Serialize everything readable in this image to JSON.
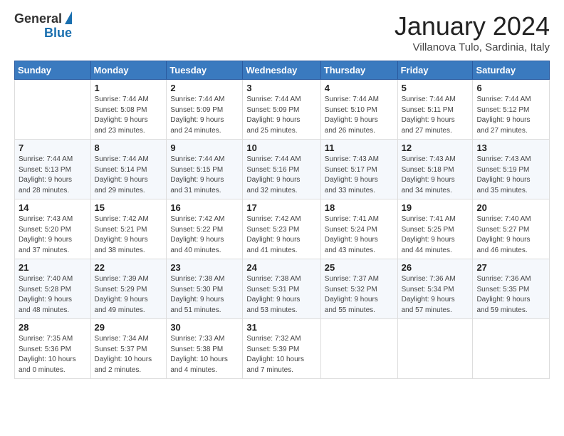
{
  "header": {
    "logo_line1": "General",
    "logo_line2": "Blue",
    "month_title": "January 2024",
    "location": "Villanova Tulo, Sardinia, Italy"
  },
  "weekdays": [
    "Sunday",
    "Monday",
    "Tuesday",
    "Wednesday",
    "Thursday",
    "Friday",
    "Saturday"
  ],
  "weeks": [
    [
      {
        "day": "",
        "info": ""
      },
      {
        "day": "1",
        "info": "Sunrise: 7:44 AM\nSunset: 5:08 PM\nDaylight: 9 hours\nand 23 minutes."
      },
      {
        "day": "2",
        "info": "Sunrise: 7:44 AM\nSunset: 5:09 PM\nDaylight: 9 hours\nand 24 minutes."
      },
      {
        "day": "3",
        "info": "Sunrise: 7:44 AM\nSunset: 5:09 PM\nDaylight: 9 hours\nand 25 minutes."
      },
      {
        "day": "4",
        "info": "Sunrise: 7:44 AM\nSunset: 5:10 PM\nDaylight: 9 hours\nand 26 minutes."
      },
      {
        "day": "5",
        "info": "Sunrise: 7:44 AM\nSunset: 5:11 PM\nDaylight: 9 hours\nand 27 minutes."
      },
      {
        "day": "6",
        "info": "Sunrise: 7:44 AM\nSunset: 5:12 PM\nDaylight: 9 hours\nand 27 minutes."
      }
    ],
    [
      {
        "day": "7",
        "info": "Sunrise: 7:44 AM\nSunset: 5:13 PM\nDaylight: 9 hours\nand 28 minutes."
      },
      {
        "day": "8",
        "info": "Sunrise: 7:44 AM\nSunset: 5:14 PM\nDaylight: 9 hours\nand 29 minutes."
      },
      {
        "day": "9",
        "info": "Sunrise: 7:44 AM\nSunset: 5:15 PM\nDaylight: 9 hours\nand 31 minutes."
      },
      {
        "day": "10",
        "info": "Sunrise: 7:44 AM\nSunset: 5:16 PM\nDaylight: 9 hours\nand 32 minutes."
      },
      {
        "day": "11",
        "info": "Sunrise: 7:43 AM\nSunset: 5:17 PM\nDaylight: 9 hours\nand 33 minutes."
      },
      {
        "day": "12",
        "info": "Sunrise: 7:43 AM\nSunset: 5:18 PM\nDaylight: 9 hours\nand 34 minutes."
      },
      {
        "day": "13",
        "info": "Sunrise: 7:43 AM\nSunset: 5:19 PM\nDaylight: 9 hours\nand 35 minutes."
      }
    ],
    [
      {
        "day": "14",
        "info": "Sunrise: 7:43 AM\nSunset: 5:20 PM\nDaylight: 9 hours\nand 37 minutes."
      },
      {
        "day": "15",
        "info": "Sunrise: 7:42 AM\nSunset: 5:21 PM\nDaylight: 9 hours\nand 38 minutes."
      },
      {
        "day": "16",
        "info": "Sunrise: 7:42 AM\nSunset: 5:22 PM\nDaylight: 9 hours\nand 40 minutes."
      },
      {
        "day": "17",
        "info": "Sunrise: 7:42 AM\nSunset: 5:23 PM\nDaylight: 9 hours\nand 41 minutes."
      },
      {
        "day": "18",
        "info": "Sunrise: 7:41 AM\nSunset: 5:24 PM\nDaylight: 9 hours\nand 43 minutes."
      },
      {
        "day": "19",
        "info": "Sunrise: 7:41 AM\nSunset: 5:25 PM\nDaylight: 9 hours\nand 44 minutes."
      },
      {
        "day": "20",
        "info": "Sunrise: 7:40 AM\nSunset: 5:27 PM\nDaylight: 9 hours\nand 46 minutes."
      }
    ],
    [
      {
        "day": "21",
        "info": "Sunrise: 7:40 AM\nSunset: 5:28 PM\nDaylight: 9 hours\nand 48 minutes."
      },
      {
        "day": "22",
        "info": "Sunrise: 7:39 AM\nSunset: 5:29 PM\nDaylight: 9 hours\nand 49 minutes."
      },
      {
        "day": "23",
        "info": "Sunrise: 7:38 AM\nSunset: 5:30 PM\nDaylight: 9 hours\nand 51 minutes."
      },
      {
        "day": "24",
        "info": "Sunrise: 7:38 AM\nSunset: 5:31 PM\nDaylight: 9 hours\nand 53 minutes."
      },
      {
        "day": "25",
        "info": "Sunrise: 7:37 AM\nSunset: 5:32 PM\nDaylight: 9 hours\nand 55 minutes."
      },
      {
        "day": "26",
        "info": "Sunrise: 7:36 AM\nSunset: 5:34 PM\nDaylight: 9 hours\nand 57 minutes."
      },
      {
        "day": "27",
        "info": "Sunrise: 7:36 AM\nSunset: 5:35 PM\nDaylight: 9 hours\nand 59 minutes."
      }
    ],
    [
      {
        "day": "28",
        "info": "Sunrise: 7:35 AM\nSunset: 5:36 PM\nDaylight: 10 hours\nand 0 minutes."
      },
      {
        "day": "29",
        "info": "Sunrise: 7:34 AM\nSunset: 5:37 PM\nDaylight: 10 hours\nand 2 minutes."
      },
      {
        "day": "30",
        "info": "Sunrise: 7:33 AM\nSunset: 5:38 PM\nDaylight: 10 hours\nand 4 minutes."
      },
      {
        "day": "31",
        "info": "Sunrise: 7:32 AM\nSunset: 5:39 PM\nDaylight: 10 hours\nand 7 minutes."
      },
      {
        "day": "",
        "info": ""
      },
      {
        "day": "",
        "info": ""
      },
      {
        "day": "",
        "info": ""
      }
    ]
  ]
}
